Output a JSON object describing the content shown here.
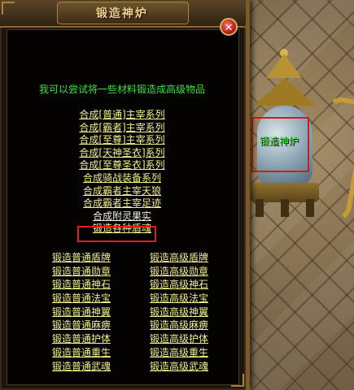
{
  "dialog": {
    "title": "锻造神炉",
    "close_symbol": "✕",
    "intro": "我可以尝试将一些材料锻造成高级物品",
    "menu_items": [
      "合成[普通]主宰系列",
      "合成[霸者]主宰系列",
      "合成[至尊]主宰系列",
      "合成[天神圣衣]系列",
      "合成[至尊圣衣]系列",
      "合成骑战装备系列",
      "合成霸者主宰天狼",
      "合成霸者主宰足迹",
      "合成附灵果实",
      "锻造各种盾魂"
    ],
    "highlighted_index": 9,
    "normal_options": [
      "锻造普通盾牌",
      "锻造普通勋章",
      "锻造普通神石",
      "锻造普通法宝",
      "锻造普通神翼",
      "锻造普通麻痹",
      "锻造普通护体",
      "锻造普通重生",
      "锻造普通武魂"
    ],
    "advanced_options": [
      "锻造高级盾牌",
      "锻造高级勋章",
      "锻造高级神石",
      "锻造高级法宝",
      "锻造高级神翼",
      "锻造高级麻痹",
      "锻造高级护体",
      "锻造高级重生",
      "锻造高级武魂"
    ]
  },
  "npc": {
    "name": "锻造神炉"
  },
  "colors": {
    "menu_text": "#f2f08a",
    "intro_text": "#39e239",
    "highlight_border": "#e21b1b",
    "npc_name": "#3fe03f"
  },
  "icons": {
    "close": "close-icon"
  }
}
